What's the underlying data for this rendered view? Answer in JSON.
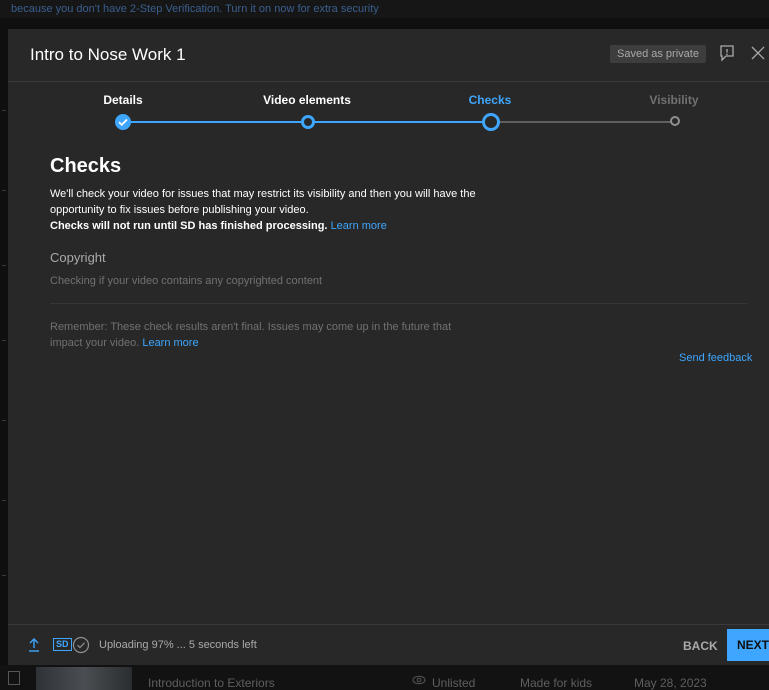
{
  "background": {
    "banner_text": "because you don't have 2-Step Verification. Turn it on now for extra security",
    "row": {
      "title": "Introduction to Exteriors",
      "visibility": "Unlisted",
      "audience": "Made for kids",
      "date": "May 28, 2023"
    }
  },
  "dialog": {
    "title": "Intro to Nose Work 1",
    "saved_badge": "Saved as private",
    "steps": [
      {
        "label": "Details",
        "state": "done"
      },
      {
        "label": "Video elements",
        "state": "done"
      },
      {
        "label": "Checks",
        "state": "current"
      },
      {
        "label": "Visibility",
        "state": "upcoming"
      }
    ],
    "checks": {
      "heading": "Checks",
      "desc_line1": "We'll check your video for issues that may restrict its visibility and then you will have the opportunity to fix issues before publishing your video.",
      "desc_bold": "Checks will not run until SD has finished processing.",
      "learn_more_1": "Learn more",
      "copyright_heading": "Copyright",
      "copyright_status": "Checking if your video contains any copyrighted content",
      "remember_text": "Remember: These check results aren't final. Issues may come up in the future that impact your video.",
      "learn_more_2": "Learn more",
      "send_feedback": "Send feedback"
    },
    "footer": {
      "sd_label": "SD",
      "upload_status": "Uploading 97% ... 5 seconds left",
      "upload_progress_percent": 97,
      "back_label": "BACK",
      "next_label": "NEXT"
    }
  },
  "colors": {
    "accent": "#3ea6ff",
    "dialog_bg": "#282828",
    "page_bg": "#0f0f0f"
  }
}
